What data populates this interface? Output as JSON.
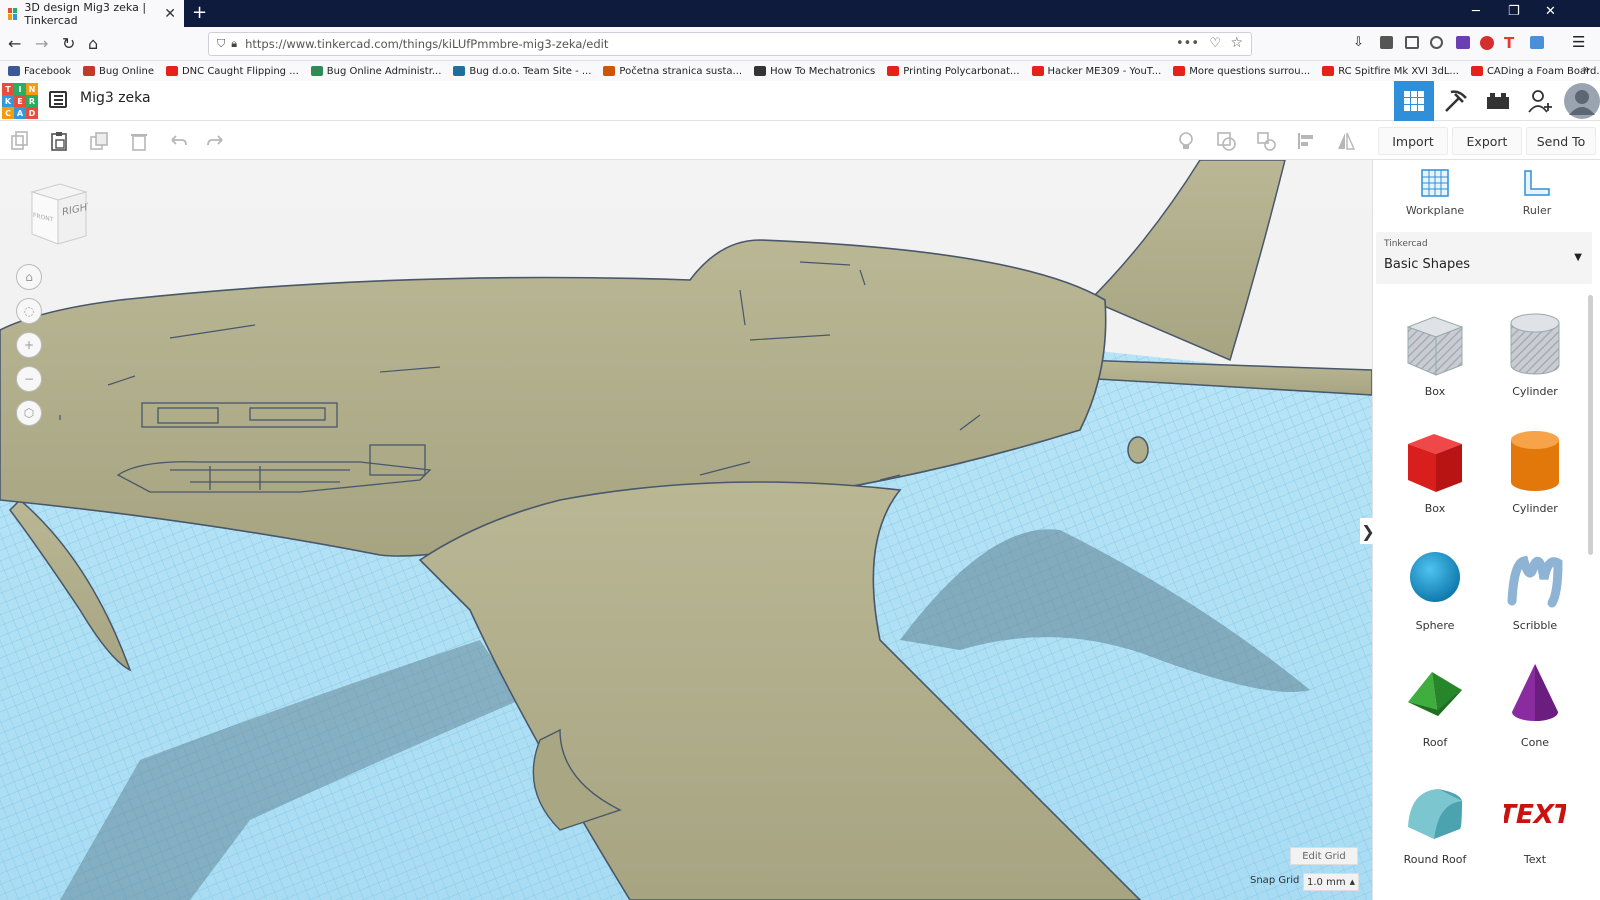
{
  "browser": {
    "tab_title": "3D design Mig3 zeka | Tinkercad",
    "url": "https://www.tinkercad.com/things/kiLUfPmmbre-mig3-zeka/edit",
    "bookmarks": [
      {
        "label": "Facebook",
        "color": "#3b5998"
      },
      {
        "label": "Bug Online",
        "color": "#c0392b"
      },
      {
        "label": "DNC Caught Flipping ...",
        "color": "#e62117"
      },
      {
        "label": "Bug Online Administr...",
        "color": "#2e8b57"
      },
      {
        "label": "Bug d.o.o. Team Site - ...",
        "color": "#1e6f9f"
      },
      {
        "label": "Početna stranica susta...",
        "color": "#d35400"
      },
      {
        "label": "How To Mechatronics",
        "color": "#333333"
      },
      {
        "label": "Printing Polycarbonat...",
        "color": "#e62117"
      },
      {
        "label": "Hacker ME309 - YouT...",
        "color": "#e62117"
      },
      {
        "label": "More questions surrou...",
        "color": "#e62117"
      },
      {
        "label": "RC Spitfire Mk XVI 3dL...",
        "color": "#e62117"
      },
      {
        "label": "CADing a Foam Board...",
        "color": "#e62117"
      }
    ]
  },
  "app": {
    "logo_letters": [
      "T",
      "I",
      "N",
      "K",
      "E",
      "R",
      "C",
      "A",
      "D"
    ],
    "design_title": "Mig3 zeka"
  },
  "toolbar": {
    "import_label": "Import",
    "export_label": "Export",
    "sendto_label": "Send To"
  },
  "viewport": {
    "viewcube_face": "RIGHT",
    "viewcube_side": "FRONT",
    "edit_grid_label": "Edit Grid",
    "snap_grid_label": "Snap Grid",
    "snap_grid_value": "1.0 mm"
  },
  "panel": {
    "workplane_label": "Workplane",
    "ruler_label": "Ruler",
    "library_group": "Tinkercad",
    "library_name": "Basic Shapes",
    "shapes": [
      {
        "label": "Box",
        "icon": "box-hole-icon"
      },
      {
        "label": "Cylinder",
        "icon": "cylinder-hole-icon"
      },
      {
        "label": "Box",
        "icon": "box-icon"
      },
      {
        "label": "Cylinder",
        "icon": "cylinder-icon"
      },
      {
        "label": "Sphere",
        "icon": "sphere-icon"
      },
      {
        "label": "Scribble",
        "icon": "scribble-icon"
      },
      {
        "label": "Roof",
        "icon": "roof-icon"
      },
      {
        "label": "Cone",
        "icon": "cone-icon"
      },
      {
        "label": "Round Roof",
        "icon": "round-roof-icon"
      },
      {
        "label": "Text",
        "icon": "text-icon"
      }
    ]
  },
  "colors": {
    "accent": "#2f8fd8",
    "model": "#b0ad8a",
    "grid": "#8fd0f0"
  }
}
